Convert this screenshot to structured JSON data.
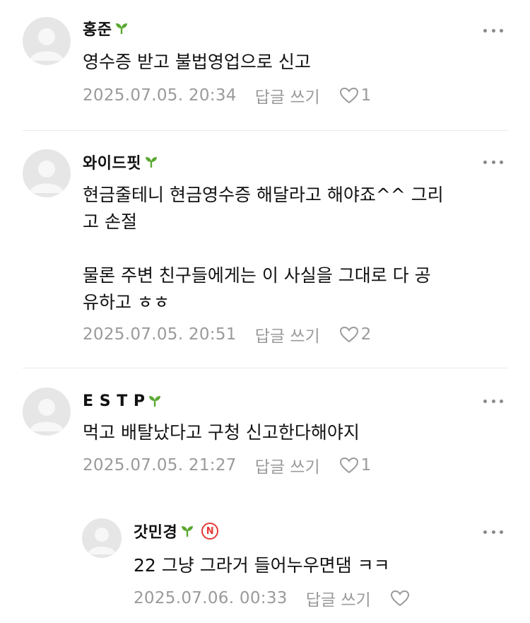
{
  "comments": [
    {
      "nickname": "홍준",
      "text": "영수증 받고 불법영업으로 신고",
      "date": "2025.07.05. 20:34",
      "reply_label": "답글 쓰기",
      "like_count": "1"
    },
    {
      "nickname": "와이드핏",
      "text": "현금줄테니 현금영수증 해달라고 해야죠^^ 그리\n고 손절\n\n물론 주변 친구들에게는 이 사실을 그대로 다 공\n유하고 ㅎㅎ",
      "date": "2025.07.05. 20:51",
      "reply_label": "답글 쓰기",
      "like_count": "2"
    },
    {
      "nickname": "E S T P",
      "text": "먹고 배탈났다고 구청 신고한다해야지",
      "date": "2025.07.05. 21:27",
      "reply_label": "답글 쓰기",
      "like_count": "1"
    }
  ],
  "reply": {
    "nickname": "갓민경",
    "badge": "N",
    "text": "22 그냥 그라거 들어누우면댐 ㅋㅋ",
    "date": "2025.07.06. 00:33",
    "reply_label": "답글 쓰기",
    "like_count": ""
  },
  "colors": {
    "sprout": "#5aa832",
    "badge": "#e53935",
    "meta": "#9a9a9a",
    "divider": "#e9e9e9"
  }
}
